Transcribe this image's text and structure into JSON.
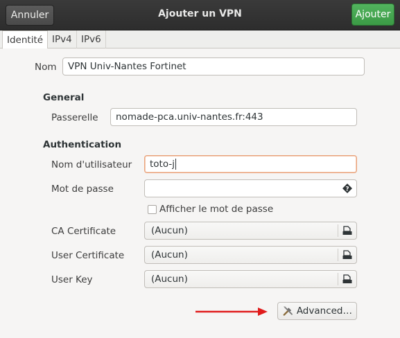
{
  "header": {
    "title": "Ajouter un VPN",
    "cancel_label": "Annuler",
    "add_label": "Ajouter"
  },
  "tabs": [
    {
      "label": "Identité",
      "active": true
    },
    {
      "label": "IPv4",
      "active": false
    },
    {
      "label": "IPv6",
      "active": false
    }
  ],
  "form": {
    "name_label": "Nom",
    "name_value": "VPN Univ-Nantes Fortinet",
    "general": {
      "heading": "General",
      "gateway_label": "Passerelle",
      "gateway_value": "nomade-pca.univ-nantes.fr:443"
    },
    "auth": {
      "heading": "Authentication",
      "username_label": "Nom d'utilisateur",
      "username_value": "toto-j",
      "password_label": "Mot de passe",
      "password_value": "",
      "show_password_label": "Afficher le mot de passe",
      "show_password_checked": false,
      "ca_cert_label": "CA Certificate",
      "ca_cert_value": "(Aucun)",
      "user_cert_label": "User Certificate",
      "user_cert_value": "(Aucun)",
      "user_key_label": "User Key",
      "user_key_value": "(Aucun)"
    },
    "advanced_label": "Advanced…"
  },
  "colors": {
    "accent_green": "#3b9a45",
    "annotation_arrow": "#e01b1b",
    "focus_border": "#e9a37c"
  }
}
